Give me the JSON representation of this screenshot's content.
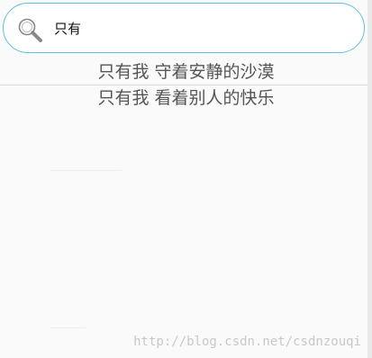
{
  "search": {
    "value": "只有",
    "icon": "search-icon"
  },
  "results": [
    {
      "label": "只有我 守着安静的沙漠"
    },
    {
      "label": "只有我 看着别人的快乐"
    }
  ],
  "watermark": "http://blog.csdn.net/csdnzouqi",
  "colors": {
    "search_border": "#5bc0de",
    "result_text": "#555555",
    "background": "#fafafa"
  }
}
